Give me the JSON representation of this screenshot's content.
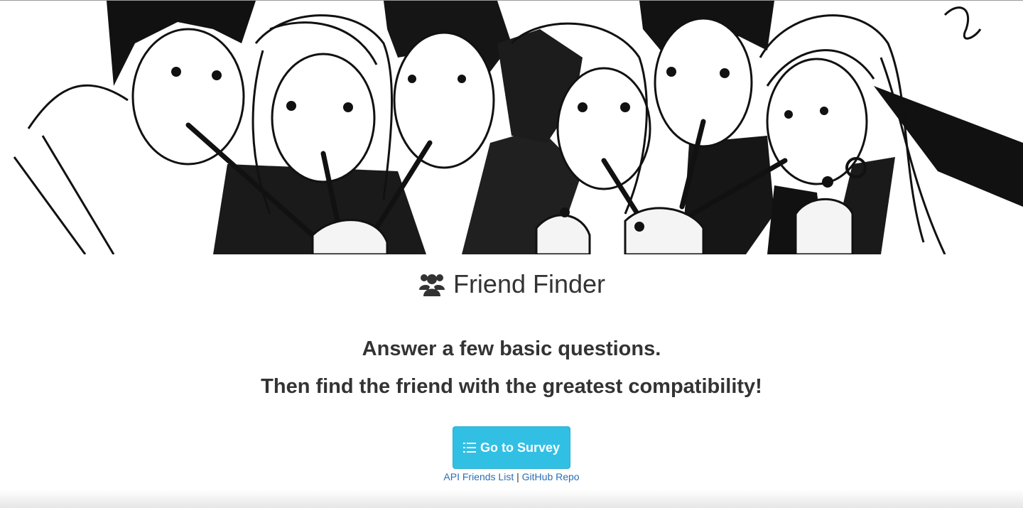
{
  "hero": {
    "image": "sketch-of-six-friends-drinking-milkshakes"
  },
  "header": {
    "icon": "users-icon",
    "title": "Friend Finder"
  },
  "main": {
    "line1": "Answer a few basic questions.",
    "line2": "Then find the friend with the greatest compatibility!",
    "survey_button": {
      "icon": "list-icon",
      "label": "Go to Survey",
      "color": "#31c0e4"
    },
    "links": {
      "api": "API Friends List",
      "separator": "|",
      "github": "GitHub Repo",
      "color": "#2a6fb5"
    }
  }
}
